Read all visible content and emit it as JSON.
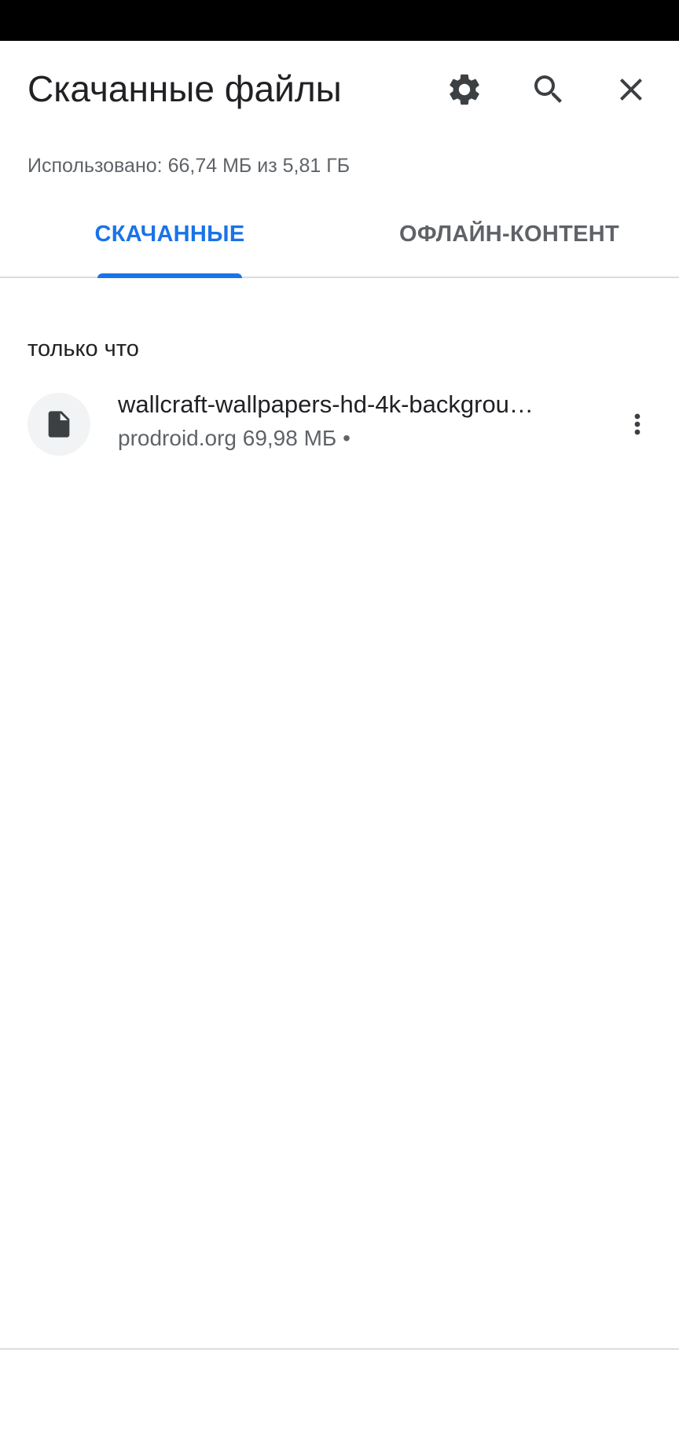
{
  "header": {
    "title": "Скачанные файлы",
    "icons": [
      "gear-icon",
      "search-icon",
      "close-icon"
    ]
  },
  "storage": {
    "text": "Использовано: 66,74 МБ из 5,81 ГБ"
  },
  "tabs": [
    {
      "label": "СКАЧАННЫЕ",
      "active": true
    },
    {
      "label": "ОФЛАЙН-КОНТЕНТ",
      "active": false
    }
  ],
  "sections": [
    {
      "header": "только что",
      "items": [
        {
          "name": "wallcraft-wallpapers-hd-4k-backgrou…",
          "meta": "prodroid.org 69,98 МБ •",
          "icon": "file-icon"
        }
      ]
    }
  ],
  "colors": {
    "accent": "#1a73e8",
    "text_primary": "#202124",
    "text_secondary": "#5f6368",
    "divider": "#dadce0",
    "icon_bg": "#f1f3f4"
  }
}
